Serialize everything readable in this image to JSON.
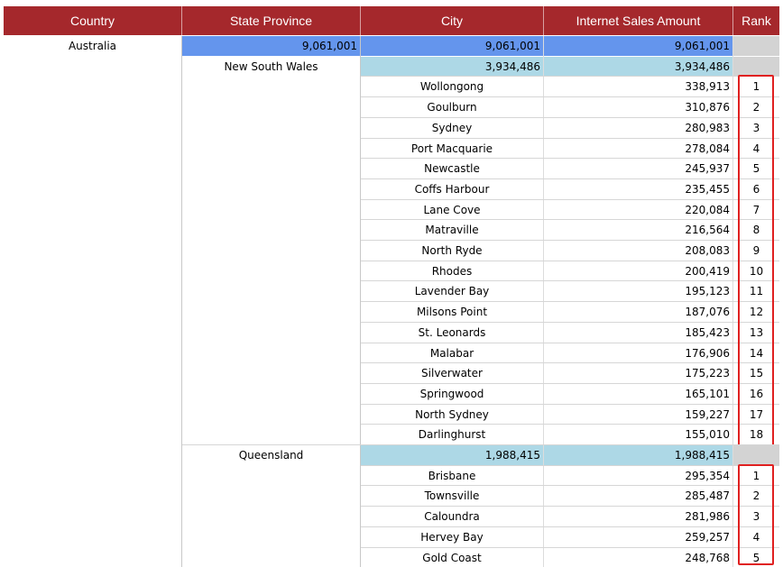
{
  "columns": {
    "country": "Country",
    "state_province": "State Province",
    "city": "City",
    "internet_sales_amount": "Internet Sales Amount",
    "rank": "Rank"
  },
  "country": {
    "name": "Australia",
    "state_total": "9,061,001",
    "city_total": "9,061,001",
    "sales_total": "9,061,001"
  },
  "states": [
    {
      "name": "New South Wales",
      "city_total": "3,934,486",
      "sales_total": "3,934,486",
      "cities": [
        {
          "city": "Wollongong",
          "amount": "338,913",
          "rank": "1"
        },
        {
          "city": "Goulburn",
          "amount": "310,876",
          "rank": "2"
        },
        {
          "city": "Sydney",
          "amount": "280,983",
          "rank": "3"
        },
        {
          "city": "Port Macquarie",
          "amount": "278,084",
          "rank": "4"
        },
        {
          "city": "Newcastle",
          "amount": "245,937",
          "rank": "5"
        },
        {
          "city": "Coffs Harbour",
          "amount": "235,455",
          "rank": "6"
        },
        {
          "city": "Lane Cove",
          "amount": "220,084",
          "rank": "7"
        },
        {
          "city": "Matraville",
          "amount": "216,564",
          "rank": "8"
        },
        {
          "city": "North Ryde",
          "amount": "208,083",
          "rank": "9"
        },
        {
          "city": "Rhodes",
          "amount": "200,419",
          "rank": "10"
        },
        {
          "city": "Lavender Bay",
          "amount": "195,123",
          "rank": "11"
        },
        {
          "city": "Milsons Point",
          "amount": "187,076",
          "rank": "12"
        },
        {
          "city": "St. Leonards",
          "amount": "185,423",
          "rank": "13"
        },
        {
          "city": "Malabar",
          "amount": "176,906",
          "rank": "14"
        },
        {
          "city": "Silverwater",
          "amount": "175,223",
          "rank": "15"
        },
        {
          "city": "Springwood",
          "amount": "165,101",
          "rank": "16"
        },
        {
          "city": "North Sydney",
          "amount": "159,227",
          "rank": "17"
        },
        {
          "city": "Darlinghurst",
          "amount": "155,010",
          "rank": "18"
        }
      ]
    },
    {
      "name": "Queensland",
      "city_total": "1,988,415",
      "sales_total": "1,988,415",
      "cities": [
        {
          "city": "Brisbane",
          "amount": "295,354",
          "rank": "1"
        },
        {
          "city": "Townsville",
          "amount": "285,487",
          "rank": "2"
        },
        {
          "city": "Caloundra",
          "amount": "281,986",
          "rank": "3"
        },
        {
          "city": "Hervey Bay",
          "amount": "259,257",
          "rank": "4"
        },
        {
          "city": "Gold Coast",
          "amount": "248,768",
          "rank": "5"
        }
      ]
    }
  ],
  "colors": {
    "header_bg": "#a5282c",
    "country_total_bg": "#6495ed",
    "state_total_bg": "#add8e6",
    "rank_blank_bg": "#d3d3d3",
    "highlight_box": "#e02020"
  }
}
